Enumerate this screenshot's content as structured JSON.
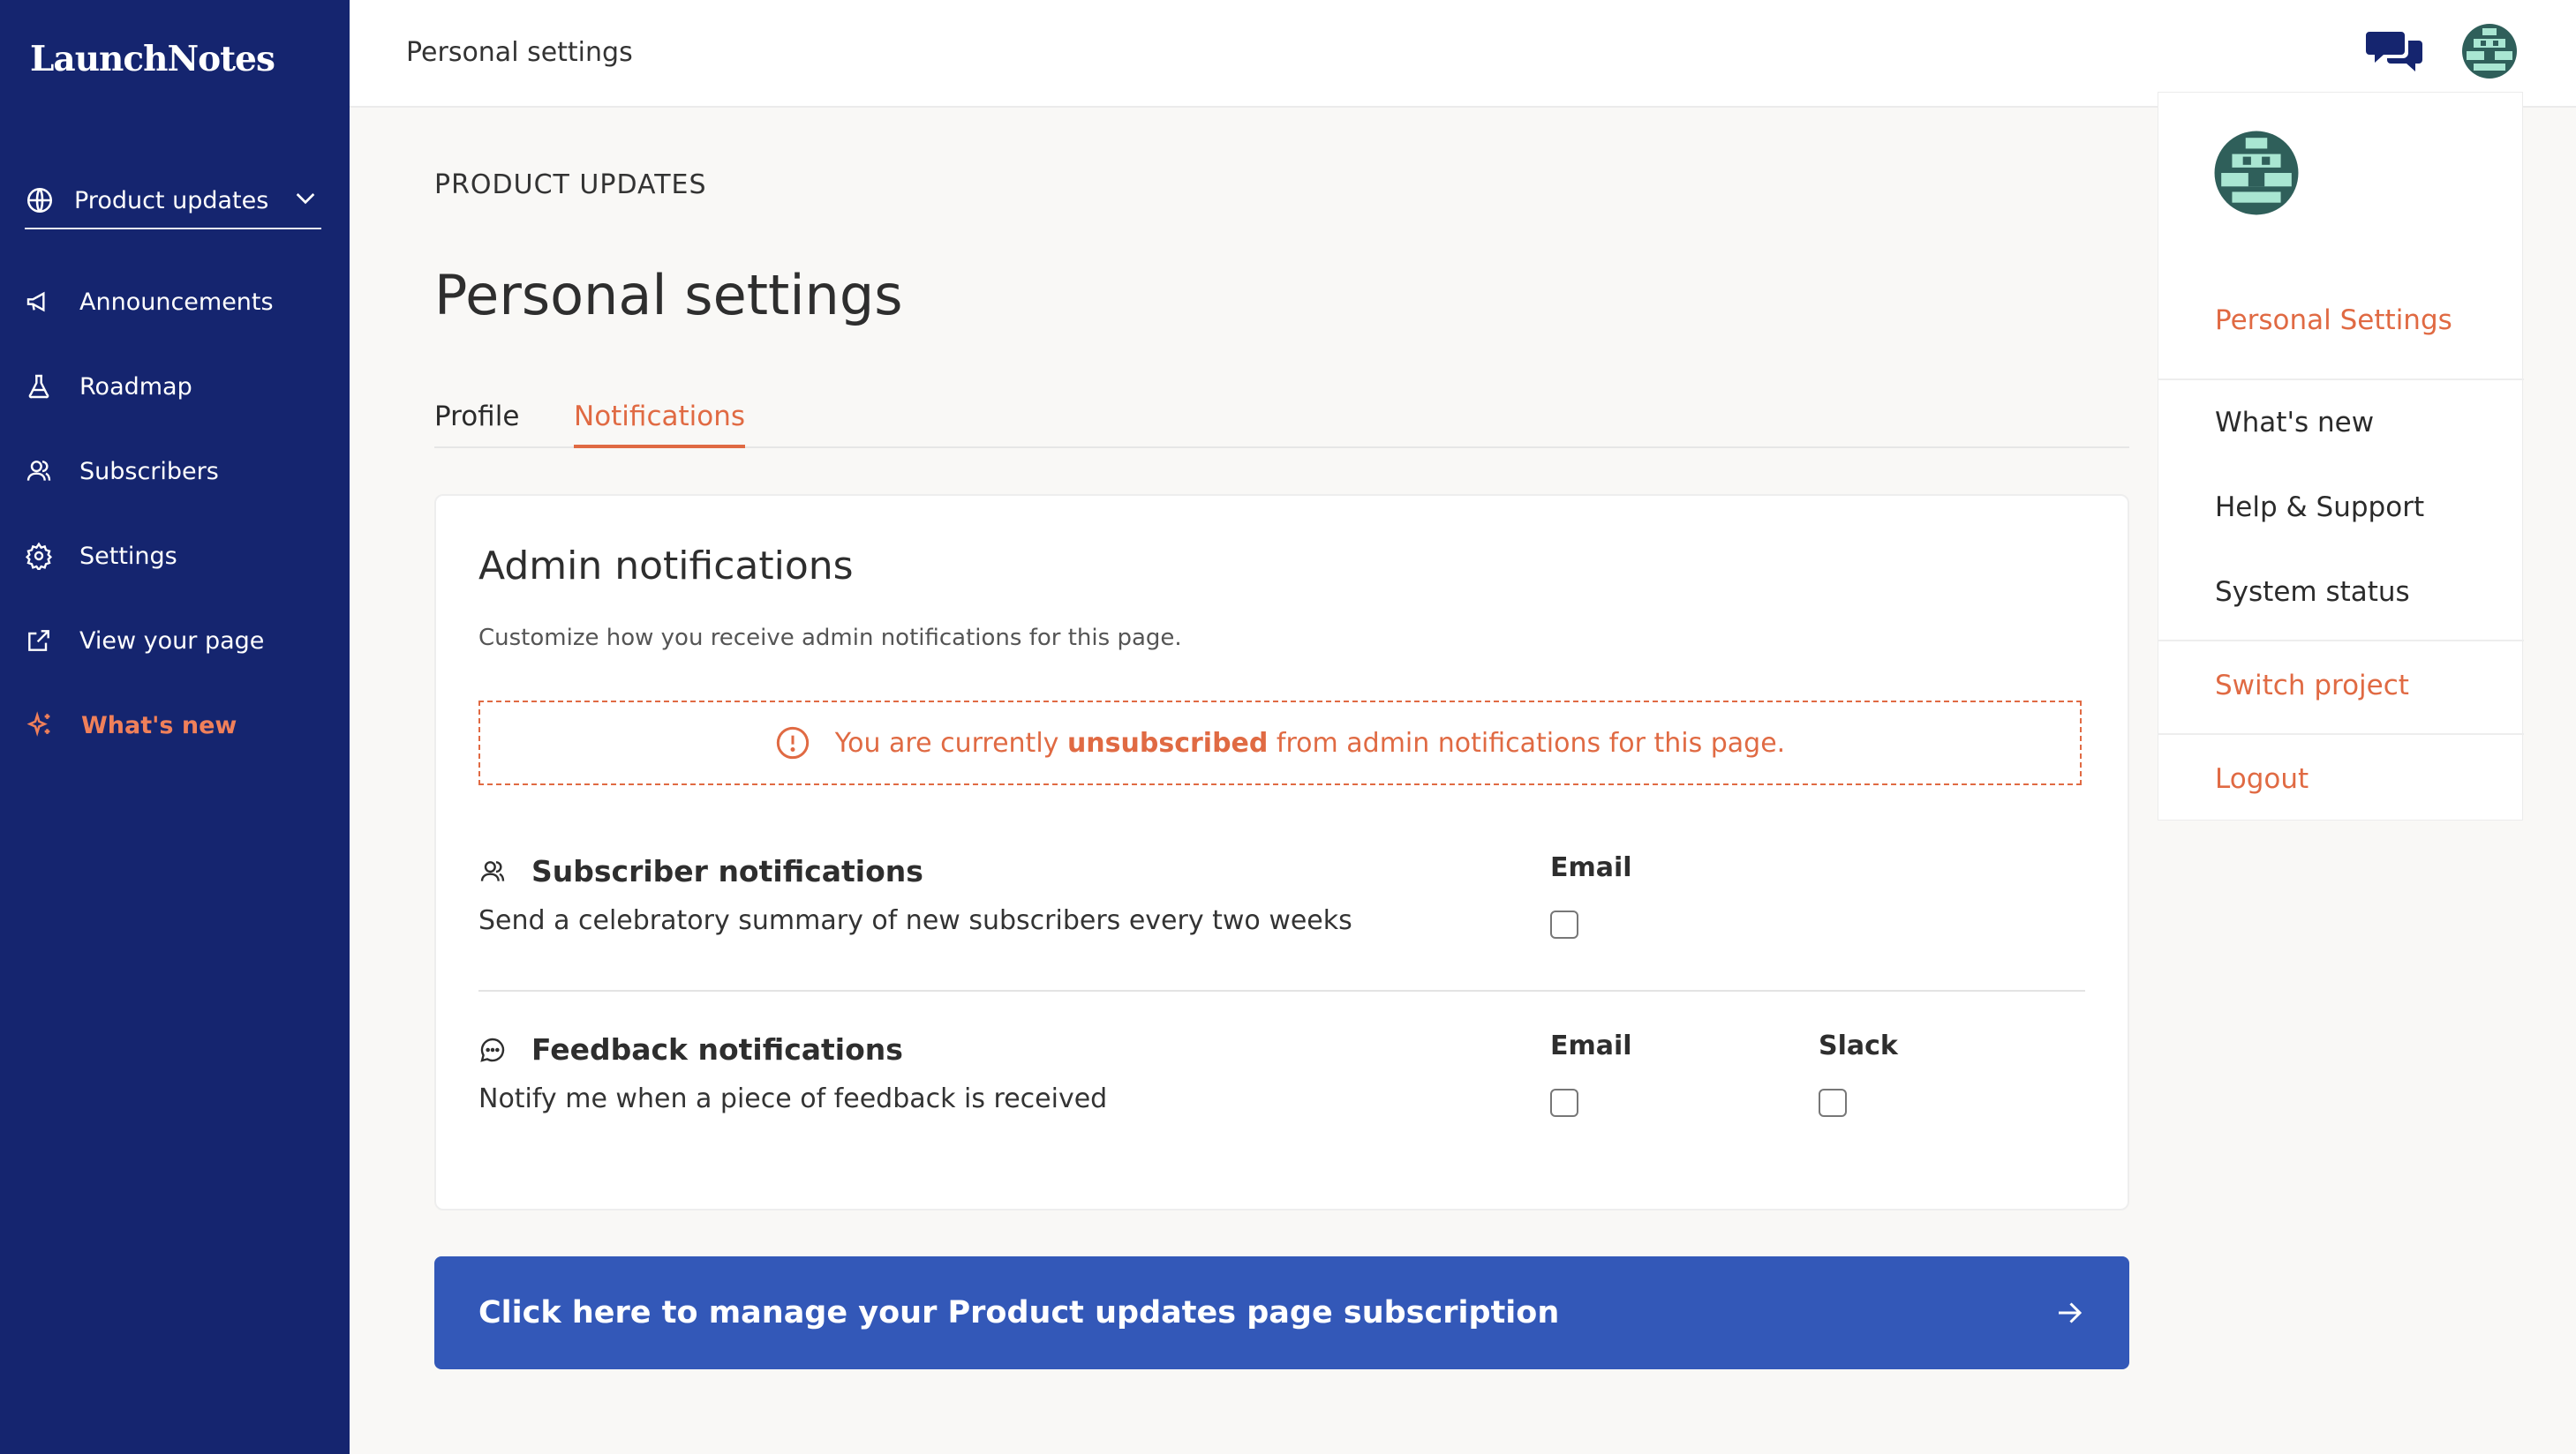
{
  "app": {
    "logo": "LaunchNotes"
  },
  "sidebar": {
    "project": "Product updates",
    "items": [
      {
        "label": "Announcements",
        "icon": "megaphone-icon"
      },
      {
        "label": "Roadmap",
        "icon": "flask-icon"
      },
      {
        "label": "Subscribers",
        "icon": "users-icon"
      },
      {
        "label": "Settings",
        "icon": "gear-icon"
      },
      {
        "label": "View your page",
        "icon": "external-link-icon"
      },
      {
        "label": "What's new",
        "icon": "sparkle-icon"
      }
    ]
  },
  "topbar": {
    "breadcrumb": "Personal settings"
  },
  "main": {
    "eyebrow": "PRODUCT UPDATES",
    "title": "Personal settings",
    "tabs": [
      {
        "label": "Profile"
      },
      {
        "label": "Notifications",
        "active": true
      }
    ],
    "card": {
      "title": "Admin notifications",
      "subtitle": "Customize how you receive admin notifications for this page.",
      "alert": {
        "pre": "You are currently ",
        "bold": "unsubscribed",
        "post": " from admin notifications for this page."
      },
      "subscriber": {
        "title": "Subscriber notifications",
        "desc": "Send a celebratory summary of new subscribers every two weeks",
        "email_label": "Email"
      },
      "feedback": {
        "title": "Feedback notifications",
        "desc": "Notify me when a piece of feedback is received",
        "email_label": "Email",
        "slack_label": "Slack"
      }
    },
    "cta": "Click here to manage your Product updates page subscription"
  },
  "menu": {
    "items": [
      {
        "label": "Personal Settings"
      },
      {
        "label": "What's new"
      },
      {
        "label": "Help & Support"
      },
      {
        "label": "System status"
      },
      {
        "label": "Switch project"
      },
      {
        "label": "Logout"
      }
    ]
  },
  "colors": {
    "sidebar": "#15256f",
    "accent": "#e06a43",
    "cta": "#3358b8",
    "avatar": "#2f5f5a",
    "avatar_light": "#a9e6d2"
  }
}
